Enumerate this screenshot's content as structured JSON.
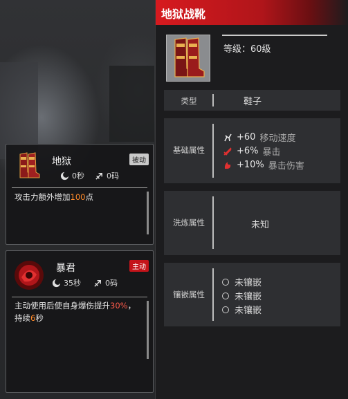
{
  "colors": {
    "accent_red": "#d71a1f",
    "highlight_orange": "#ff8a2a",
    "highlight_red": "#ff5a4a"
  },
  "skill_cards": [
    {
      "title": "地狱",
      "badge": "被动",
      "cooldown": "0秒",
      "range": "0码",
      "desc_prefix": "攻击力额外增加",
      "desc_value": "100",
      "desc_suffix": "点",
      "icon": "hell-boots-icon"
    },
    {
      "title": "暴君",
      "badge": "主动",
      "cooldown": "35秒",
      "range": "0码",
      "desc_prefix": "主动使用后使自身爆伤提升",
      "desc_value": "30%",
      "desc_mid": "，持续",
      "desc_value2": "6",
      "desc_suffix": "秒",
      "icon": "tyrant-icon"
    }
  ],
  "item": {
    "name": "地狱战靴",
    "level": "等级：60级",
    "type_label": "类型",
    "type_value": "鞋子",
    "base_label": "基础属性",
    "base_attrs": [
      {
        "value": "+60",
        "name": "移动速度",
        "icon": "move-speed-icon"
      },
      {
        "value": "+6%",
        "name": "暴击",
        "icon": "crit-icon"
      },
      {
        "value": "+10%",
        "name": "暴击伤害",
        "icon": "crit-damage-icon"
      }
    ],
    "wash_label": "洗炼属性",
    "wash_value": "未知",
    "inlay_label": "镶嵌属性",
    "inlay_slots": [
      "未镶嵌",
      "未镶嵌",
      "未镶嵌"
    ]
  }
}
